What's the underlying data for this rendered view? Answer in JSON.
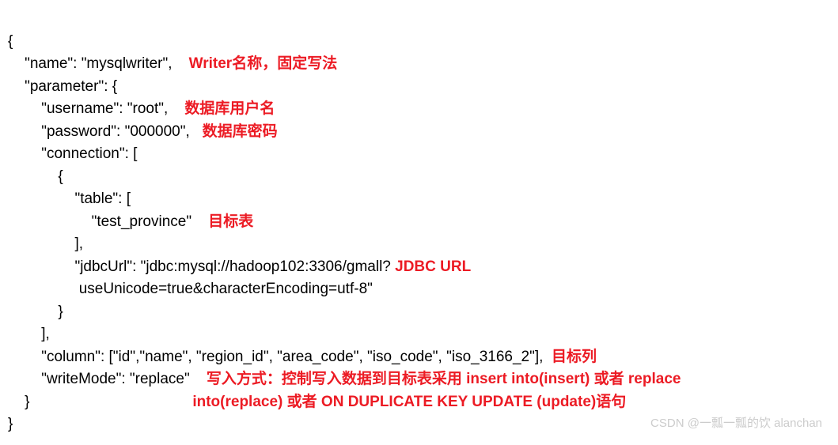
{
  "code": {
    "line1": "{",
    "line2": "    \"name\": \"mysqlwriter\",    ",
    "line3": "    \"parameter\": {",
    "line4": "        \"username\": \"root\",    ",
    "line5": "        \"password\": \"000000\",   ",
    "line6": "        \"connection\": [",
    "line7": "            {",
    "line8": "                \"table\": [",
    "line9": "                    \"test_province\"    ",
    "line10": "                ],",
    "line11": "                \"jdbcUrl\": \"jdbc:mysql://hadoop102:3306/gmall? ",
    "line12": "                 useUnicode=true&characterEncoding=utf-8\"",
    "line13": "            }",
    "line14": "        ],",
    "line15": "        \"column\": [\"id\",\"name\", \"region_id\", \"area_code\", \"iso_code\", \"iso_3166_2\"],  ",
    "line16": "        \"writeMode\": \"replace\"    ",
    "line17": "    }",
    "line18": "}"
  },
  "annotations": {
    "writer_name": "Writer名称，固定写法",
    "db_username": "数据库用户名",
    "db_password": "数据库密码",
    "target_table": "目标表",
    "jdbc_url": "JDBC URL",
    "target_column": "目标列",
    "write_mode_line1": "写入方式：控制写入数据到目标表采用 insert into(insert) 或者 replace",
    "write_mode_line2": "                                       into(replace) 或者 ON DUPLICATE KEY UPDATE (update)语句"
  },
  "watermark": "CSDN @一瓢一瓢的饮 alanchan"
}
